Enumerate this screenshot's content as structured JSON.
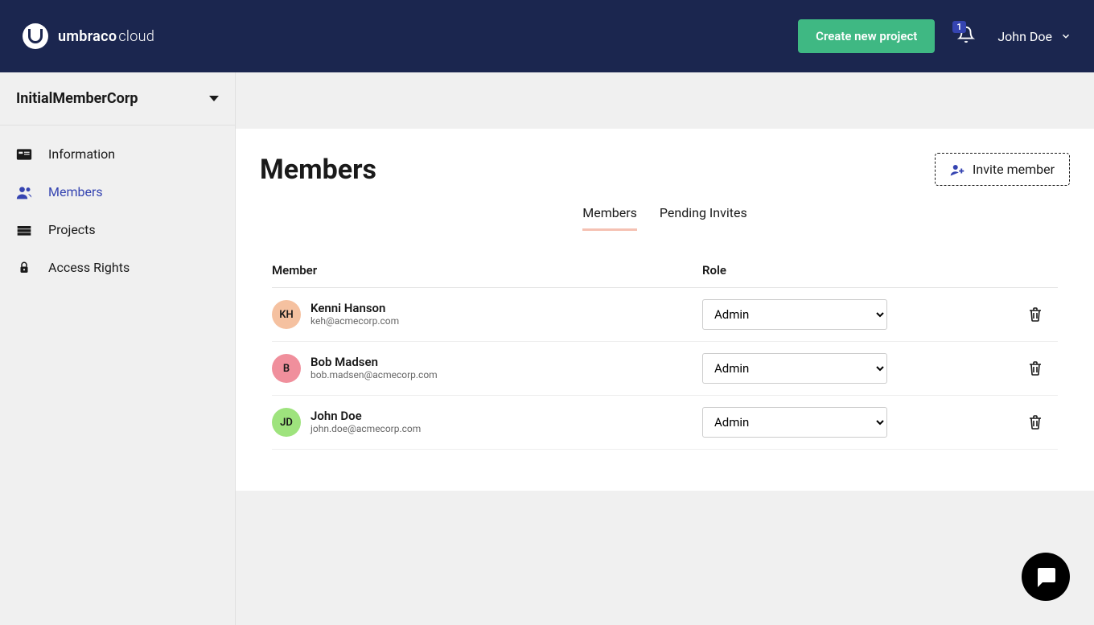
{
  "header": {
    "brand_main": "umbraco",
    "brand_sub": "cloud",
    "create_project": "Create new project",
    "notif_count": "1",
    "user_name": "John Doe"
  },
  "sidebar": {
    "org_name": "InitialMemberCorp",
    "items": [
      {
        "label": "Information"
      },
      {
        "label": "Members"
      },
      {
        "label": "Projects"
      },
      {
        "label": "Access Rights"
      }
    ]
  },
  "page": {
    "title": "Members",
    "invite_label": "Invite member",
    "tabs": [
      {
        "label": "Members"
      },
      {
        "label": "Pending Invites"
      }
    ],
    "columns": {
      "member": "Member",
      "role": "Role"
    },
    "role_options": [
      "Admin"
    ],
    "members": [
      {
        "initials": "KH",
        "name": "Kenni Hanson",
        "email": "keh@acmecorp.com",
        "role": "Admin",
        "avatar_bg": "#f5c1a0"
      },
      {
        "initials": "B",
        "name": "Bob Madsen",
        "email": "bob.madsen@acmecorp.com",
        "role": "Admin",
        "avatar_bg": "#f08f9c"
      },
      {
        "initials": "JD",
        "name": "John Doe",
        "email": "john.doe@acmecorp.com",
        "role": "Admin",
        "avatar_bg": "#9ee37d"
      }
    ]
  }
}
